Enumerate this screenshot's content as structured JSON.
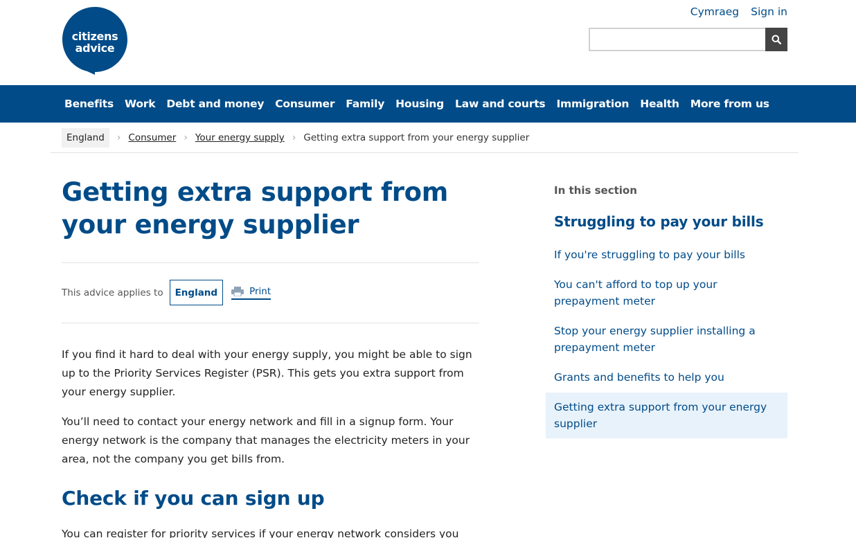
{
  "header": {
    "logo_line1": "citizens",
    "logo_line2": "advice",
    "links": [
      "Cymraeg",
      "Sign in"
    ],
    "search_placeholder": ""
  },
  "nav": {
    "items": [
      "Benefits",
      "Work",
      "Debt and money",
      "Consumer",
      "Family",
      "Housing",
      "Law and courts",
      "Immigration",
      "Health",
      "More from us"
    ]
  },
  "breadcrumb": {
    "home": "England",
    "items": [
      "Consumer",
      "Your energy supply"
    ],
    "current": "Getting extra support from your energy supplier"
  },
  "main": {
    "title": "Getting extra support from your energy supplier",
    "applies_label": "This advice applies to",
    "nation": "England",
    "print_label": "Print",
    "paragraphs": [
      "If you find it hard to deal with your energy supply, you might be able to sign up to the Priority Services Register (PSR). This gets you extra support from your energy supplier.",
      "You’ll need to contact your energy network and fill in a signup form. Your energy network is the company that manages the electricity meters in your area, not the company you get bills from."
    ],
    "subheading": "Check if you can sign up",
    "paragraph3": "You can register for priority services if your energy network considers you"
  },
  "sidebar": {
    "label": "In this section",
    "heading": "Struggling to pay your bills",
    "items": [
      "If you're struggling to pay your bills",
      "You can't afford to top up your prepayment meter",
      "Stop your energy supplier installing a prepayment meter",
      "Grants and benefits to help you",
      "Getting extra support from your energy supplier"
    ],
    "active_index": 4
  },
  "colors": {
    "brand_blue": "#004b88",
    "active_bg": "#e8f2fb"
  }
}
